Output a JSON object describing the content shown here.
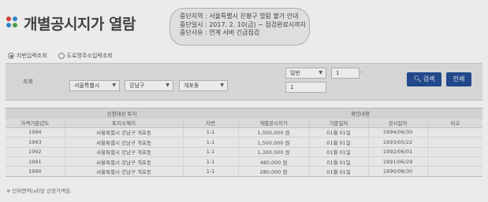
{
  "header": {
    "title": "개별공시지가 열람"
  },
  "notice": {
    "lines": [
      "중단지역 : 서울특별시 은평구 열람 불가 안내",
      "중단일시 : 2017. 2. 10(금) ~ 점검완료시까지",
      "중단사유 : 연계 서버 긴급점검"
    ]
  },
  "search_type": {
    "options": [
      {
        "label": "지번입력조회",
        "selected": true
      },
      {
        "label": "도로명주소입력조회",
        "selected": false
      }
    ]
  },
  "search": {
    "label": "조회",
    "sido": "서울특별시",
    "sigungu": "강남구",
    "dong": "개포동",
    "land_type": "일반",
    "bonbun": "1",
    "tilde": "-",
    "bubun": "1",
    "search_button": "검색",
    "print_button": "인쇄"
  },
  "table": {
    "group_headers": [
      "신청대상 토지",
      "확인내용"
    ],
    "columns": [
      "가격기준년도",
      "토지소재지",
      "지번",
      "개별공시지가",
      "기준일자",
      "공시일자",
      "비고"
    ],
    "rows": [
      [
        "1994",
        "서울특별시 강남구 개포동",
        "1-1",
        "1,500,000 원",
        "01월 01일",
        "1994/06/30",
        ""
      ],
      [
        "1993",
        "서울특별시 강남구 개포동",
        "1-1",
        "1,500,000 원",
        "01월 01일",
        "1993/05/22",
        ""
      ],
      [
        "1992",
        "서울특별시 강남구 개포동",
        "1-1",
        "1,300,000 원",
        "01월 01일",
        "1992/06/01",
        ""
      ],
      [
        "1991",
        "서울특별시 강남구 개포동",
        "1-1",
        "480,000 원",
        "01월 01일",
        "1991/06/29",
        ""
      ],
      [
        "1990",
        "서울특별시 강남구 개포동",
        "1-1",
        "280,000 원",
        "01월 01일",
        "1990/08/30",
        ""
      ]
    ]
  },
  "footnote": "※ 단위면적(㎡)당 산정가격임."
}
